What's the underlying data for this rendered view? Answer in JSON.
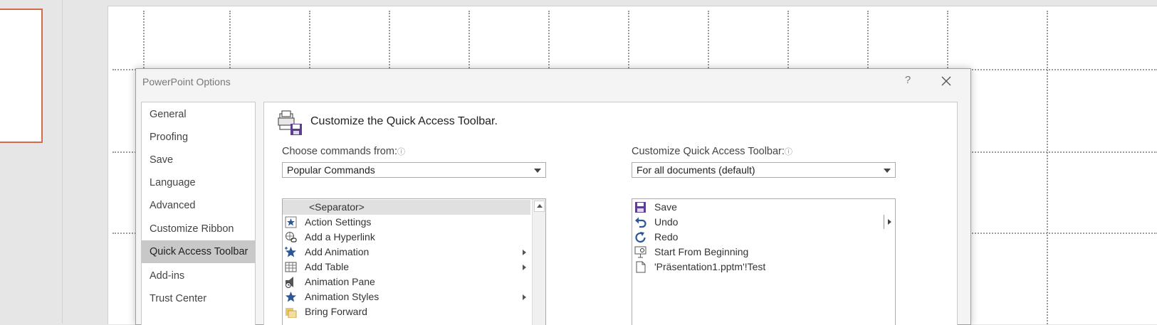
{
  "dialog": {
    "title": "PowerPoint Options",
    "help_label": "?"
  },
  "nav": {
    "items": [
      {
        "label": "General"
      },
      {
        "label": "Proofing"
      },
      {
        "label": "Save"
      },
      {
        "label": "Language"
      },
      {
        "label": "Advanced"
      },
      {
        "label": "Customize Ribbon"
      },
      {
        "label": "Quick Access Toolbar"
      },
      {
        "label": "Add-ins"
      },
      {
        "label": "Trust Center"
      }
    ],
    "selected": "Quick Access Toolbar"
  },
  "main": {
    "heading": "Customize the Quick Access Toolbar.",
    "choose_label": "Choose commands from:",
    "choose_value": "Popular Commands",
    "customize_label": "Customize Quick Access Toolbar:",
    "customize_value": "For all documents (default)",
    "info_glyph": "ⓘ"
  },
  "commands": [
    {
      "label": "<Separator>",
      "icon": "none",
      "submenu": false
    },
    {
      "label": "Action Settings",
      "icon": "action-settings-icon",
      "submenu": false
    },
    {
      "label": "Add a Hyperlink",
      "icon": "hyperlink-icon",
      "submenu": false
    },
    {
      "label": "Add Animation",
      "icon": "add-animation-icon",
      "submenu": true
    },
    {
      "label": "Add Table",
      "icon": "table-icon",
      "submenu": true
    },
    {
      "label": "Animation Pane",
      "icon": "animation-pane-icon",
      "submenu": false
    },
    {
      "label": "Animation Styles",
      "icon": "animation-styles-icon",
      "submenu": true
    },
    {
      "label": "Bring Forward",
      "icon": "bring-forward-icon",
      "submenu": false
    }
  ],
  "toolbar_items": [
    {
      "label": "Save",
      "icon": "save-icon"
    },
    {
      "label": "Undo",
      "icon": "undo-icon"
    },
    {
      "label": "Redo",
      "icon": "redo-icon"
    },
    {
      "label": "Start From Beginning",
      "icon": "slideshow-icon"
    },
    {
      "label": "'Präsentation1.pptm'!Test",
      "icon": "macro-document-icon"
    }
  ],
  "colors": {
    "thumbnail_border": "#d26b4a",
    "nav_selected": "#c8c8c8",
    "icon_blue": "#2b5797",
    "icon_purple": "#5c3f8f"
  }
}
